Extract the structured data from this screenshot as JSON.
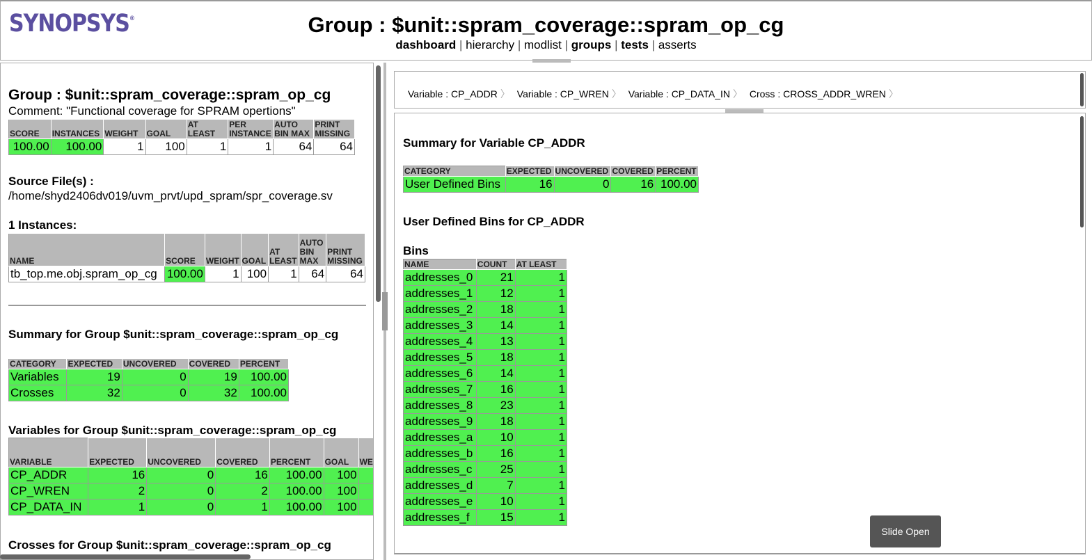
{
  "brand": {
    "name": "SYNOPSYS",
    "mark": "®"
  },
  "page_title": "Group : $unit::spram_coverage::spram_op_cg",
  "nav": {
    "dashboard": "dashboard",
    "hierarchy": "hierarchy",
    "modlist": "modlist",
    "groups": "groups",
    "tests": "tests",
    "asserts": "asserts",
    "sep": "|"
  },
  "left": {
    "group_title": "Group : $unit::spram_coverage::spram_op_cg",
    "comment": "Comment: \"Functional coverage for SPRAM opertions\"",
    "score_table": {
      "headers": [
        "SCORE",
        "INSTANCES",
        "WEIGHT",
        "GOAL",
        "AT LEAST",
        "PER INSTANCE",
        "AUTO BIN MAX",
        "PRINT MISSING"
      ],
      "row": [
        "100.00",
        "100.00",
        "1",
        "100",
        "1",
        "1",
        "64",
        "64"
      ]
    },
    "source_label": "Source File(s) :",
    "source_path": "/home/shyd2406dv019/uvm_prvt/upd_spram/spr_coverage.sv",
    "instances_label": "1 Instances:",
    "instances_table": {
      "headers": [
        "NAME",
        "SCORE",
        "WEIGHT",
        "GOAL",
        "AT LEAST",
        "AUTO BIN MAX",
        "PRINT MISSING"
      ],
      "row": [
        "tb_top.me.obj.spram_op_cg",
        "100.00",
        "1",
        "100",
        "1",
        "64",
        "64"
      ]
    },
    "summary_title": "Summary for Group $unit::spram_coverage::spram_op_cg",
    "summary_table": {
      "headers": [
        "CATEGORY",
        "EXPECTED",
        "UNCOVERED",
        "COVERED",
        "PERCENT"
      ],
      "rows": [
        [
          "Variables",
          "19",
          "0",
          "19",
          "100.00"
        ],
        [
          "Crosses",
          "32",
          "0",
          "32",
          "100.00"
        ]
      ]
    },
    "variables_title": "Variables for Group $unit::spram_coverage::spram_op_cg",
    "variables_table": {
      "headers": [
        "VARIABLE",
        "EXPECTED",
        "UNCOVERED",
        "COVERED",
        "PERCENT",
        "GOAL",
        "WEIGHT"
      ],
      "rows": [
        [
          "CP_ADDR",
          "16",
          "0",
          "16",
          "100.00",
          "100"
        ],
        [
          "CP_WREN",
          "2",
          "0",
          "2",
          "100.00",
          "100"
        ],
        [
          "CP_DATA_IN",
          "1",
          "0",
          "1",
          "100.00",
          "100"
        ]
      ]
    },
    "crosses_title": "Crosses for Group $unit::spram_coverage::spram_op_cg"
  },
  "right": {
    "breadcrumbs": [
      "Variable : CP_ADDR",
      "Variable : CP_WREN",
      "Variable : CP_DATA_IN",
      "Cross : CROSS_ADDR_WREN"
    ],
    "summary_title": "Summary for Variable CP_ADDR",
    "summary_table": {
      "headers": [
        "CATEGORY",
        "EXPECTED",
        "UNCOVERED",
        "COVERED",
        "PERCENT"
      ],
      "row": [
        "User Defined Bins",
        "16",
        "0",
        "16",
        "100.00"
      ]
    },
    "udb_title": "User Defined Bins for CP_ADDR",
    "bins_label": "Bins",
    "bins_table": {
      "headers": [
        "NAME",
        "COUNT",
        "AT LEAST"
      ],
      "rows": [
        [
          "addresses_0",
          "21",
          "1"
        ],
        [
          "addresses_1",
          "12",
          "1"
        ],
        [
          "addresses_2",
          "18",
          "1"
        ],
        [
          "addresses_3",
          "14",
          "1"
        ],
        [
          "addresses_4",
          "13",
          "1"
        ],
        [
          "addresses_5",
          "18",
          "1"
        ],
        [
          "addresses_6",
          "14",
          "1"
        ],
        [
          "addresses_7",
          "16",
          "1"
        ],
        [
          "addresses_8",
          "23",
          "1"
        ],
        [
          "addresses_9",
          "18",
          "1"
        ],
        [
          "addresses_a",
          "10",
          "1"
        ],
        [
          "addresses_b",
          "16",
          "1"
        ],
        [
          "addresses_c",
          "25",
          "1"
        ],
        [
          "addresses_d",
          "7",
          "1"
        ],
        [
          "addresses_e",
          "10",
          "1"
        ],
        [
          "addresses_f",
          "15",
          "1"
        ]
      ]
    },
    "slide_button": "Slide Open"
  }
}
